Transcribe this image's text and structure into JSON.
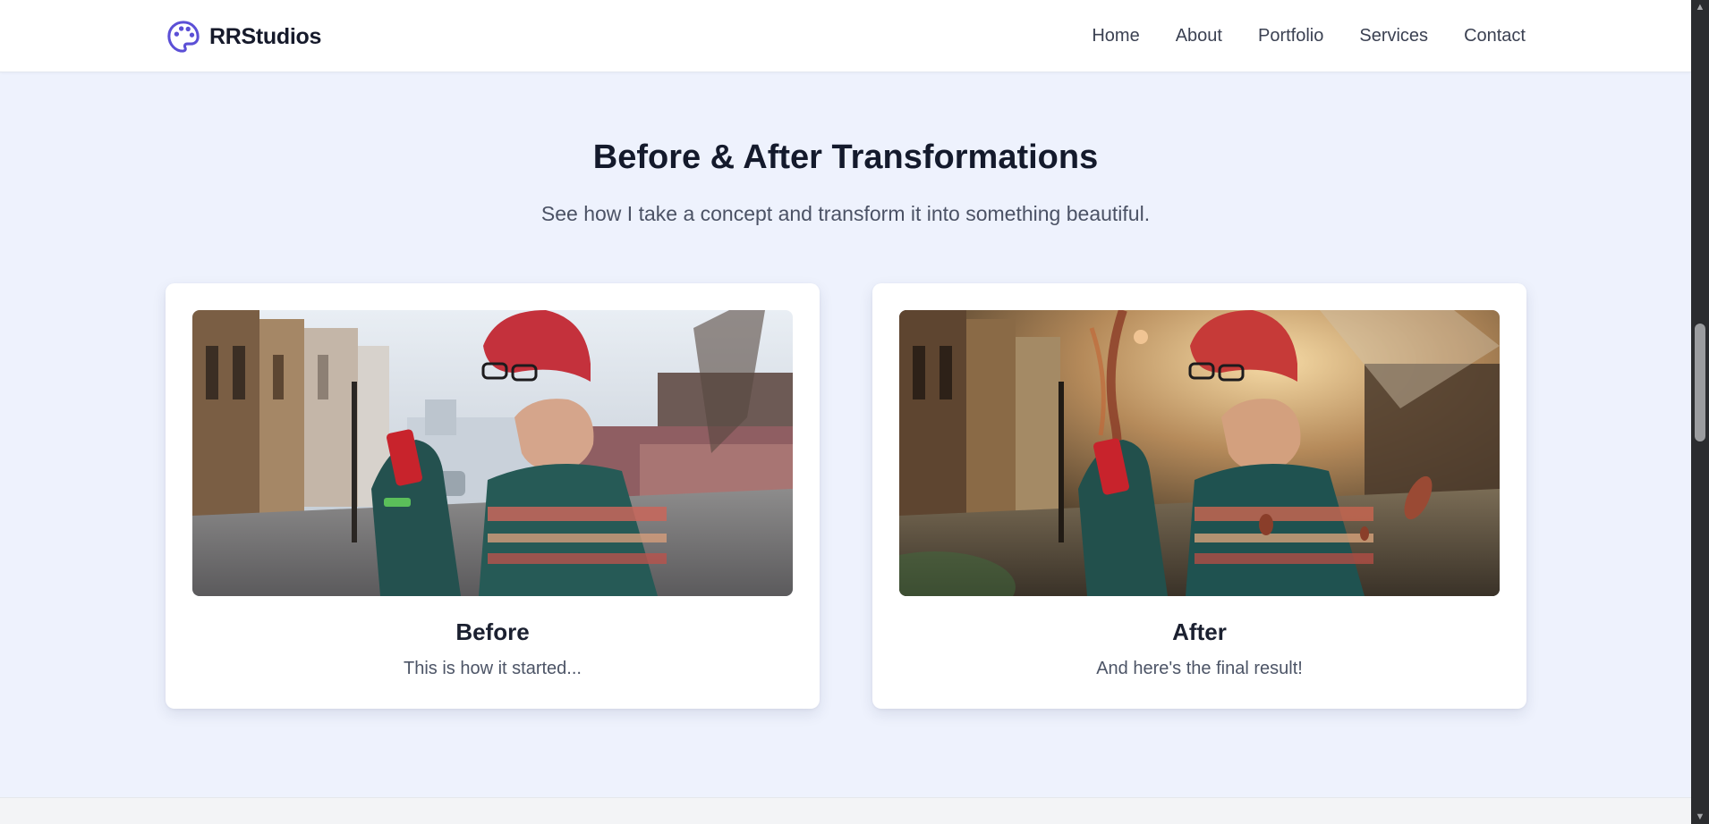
{
  "navbar": {
    "brand": "RRStudios",
    "brand_icon": "palette-icon",
    "brand_color": "#5b4fd6",
    "links": [
      "Home",
      "About",
      "Portfolio",
      "Services",
      "Contact"
    ]
  },
  "section": {
    "title": "Before & After Transformations",
    "subtitle": "See how I take a concept and transform it into something beautiful."
  },
  "cards": [
    {
      "title": "Before",
      "text": "This is how it started...",
      "image": "man-with-soda-can-street-photo"
    },
    {
      "title": "After",
      "text": "And here's the final result!",
      "image": "man-with-soda-can-edited-fantasy-photo"
    }
  ]
}
